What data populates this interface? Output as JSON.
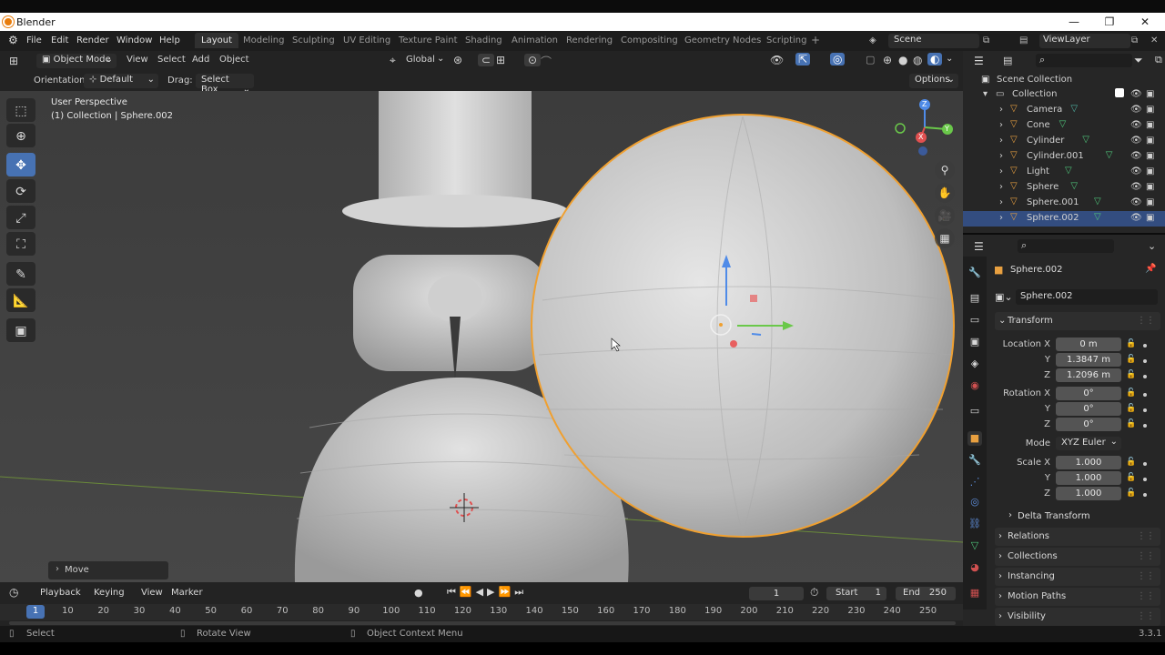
{
  "window": {
    "title": "Blender",
    "minimize": "—",
    "maximize": "❐",
    "close": "✕"
  },
  "menu": {
    "file": "File",
    "edit": "Edit",
    "render": "Render",
    "window": "Window",
    "help": "Help"
  },
  "workspaces": [
    "Layout",
    "Modeling",
    "Sculpting",
    "UV Editing",
    "Texture Paint",
    "Shading",
    "Animation",
    "Rendering",
    "Compositing",
    "Geometry Nodes",
    "Scripting"
  ],
  "workspace_add": "+",
  "scene": {
    "label": "Scene",
    "viewlayer": "ViewLayer"
  },
  "viewport_header": {
    "mode": "Object Mode",
    "view": "View",
    "select": "Select",
    "add": "Add",
    "object": "Object",
    "transform_orientation": "Global",
    "options": "Options",
    "orientation_label": "Orientation:",
    "orientation_value": "Default",
    "drag_label": "Drag:",
    "drag_value": "Select Box"
  },
  "viewport": {
    "perspective": "User Perspective",
    "collection_info": "(1) Collection | Sphere.002",
    "last_op": "Move"
  },
  "gizmo": {
    "x": "X",
    "y": "Y",
    "z": "Z"
  },
  "outliner": {
    "root": "Scene Collection",
    "collection": "Collection",
    "items": [
      {
        "name": "Camera",
        "icon_color": "#e8a040",
        "data_color": "#4fb3a3",
        "selected": false
      },
      {
        "name": "Cone",
        "icon_color": "#e8a040",
        "data_color": "#4fc47a",
        "selected": false
      },
      {
        "name": "Cylinder",
        "icon_color": "#e8a040",
        "data_color": "#4fc47a",
        "selected": false
      },
      {
        "name": "Cylinder.001",
        "icon_color": "#e8a040",
        "data_color": "#4fc47a",
        "selected": false
      },
      {
        "name": "Light",
        "icon_color": "#e8a040",
        "data_color": "#4fc47a",
        "selected": false
      },
      {
        "name": "Sphere",
        "icon_color": "#e8a040",
        "data_color": "#4fc47a",
        "selected": false
      },
      {
        "name": "Sphere.001",
        "icon_color": "#e8a040",
        "data_color": "#4fc47a",
        "selected": false
      },
      {
        "name": "Sphere.002",
        "icon_color": "#e8a040",
        "data_color": "#4fc47a",
        "selected": true
      }
    ]
  },
  "properties": {
    "object_name": "Sphere.002",
    "object_field": "Sphere.002",
    "transform": "Transform",
    "location_label": "Location X",
    "location": {
      "x": "0 m",
      "y": "1.3847 m",
      "z": "1.2096 m"
    },
    "rotation_label": "Rotation X",
    "rotation": {
      "x": "0°",
      "y": "0°",
      "z": "0°"
    },
    "mode_label": "Mode",
    "mode_value": "XYZ Euler",
    "scale_label": "Scale X",
    "scale": {
      "x": "1.000",
      "y": "1.000",
      "z": "1.000"
    },
    "axis_y": "Y",
    "axis_z": "Z",
    "delta_transform": "Delta Transform",
    "panels": [
      "Relations",
      "Collections",
      "Instancing",
      "Motion Paths",
      "Visibility"
    ]
  },
  "timeline": {
    "playback": "Playback",
    "keying": "Keying",
    "view": "View",
    "marker": "Marker",
    "current_frame": "1",
    "start_label": "Start",
    "start": "1",
    "end_label": "End",
    "end": "250",
    "ticks": [
      "1",
      "10",
      "20",
      "30",
      "40",
      "50",
      "60",
      "70",
      "80",
      "90",
      "100",
      "110",
      "120",
      "130",
      "140",
      "150",
      "160",
      "170",
      "180",
      "190",
      "200",
      "210",
      "220",
      "230",
      "240",
      "250"
    ]
  },
  "status": {
    "select": "Select",
    "rotate": "Rotate View",
    "context": "Object Context Menu",
    "version": "3.3.1"
  }
}
